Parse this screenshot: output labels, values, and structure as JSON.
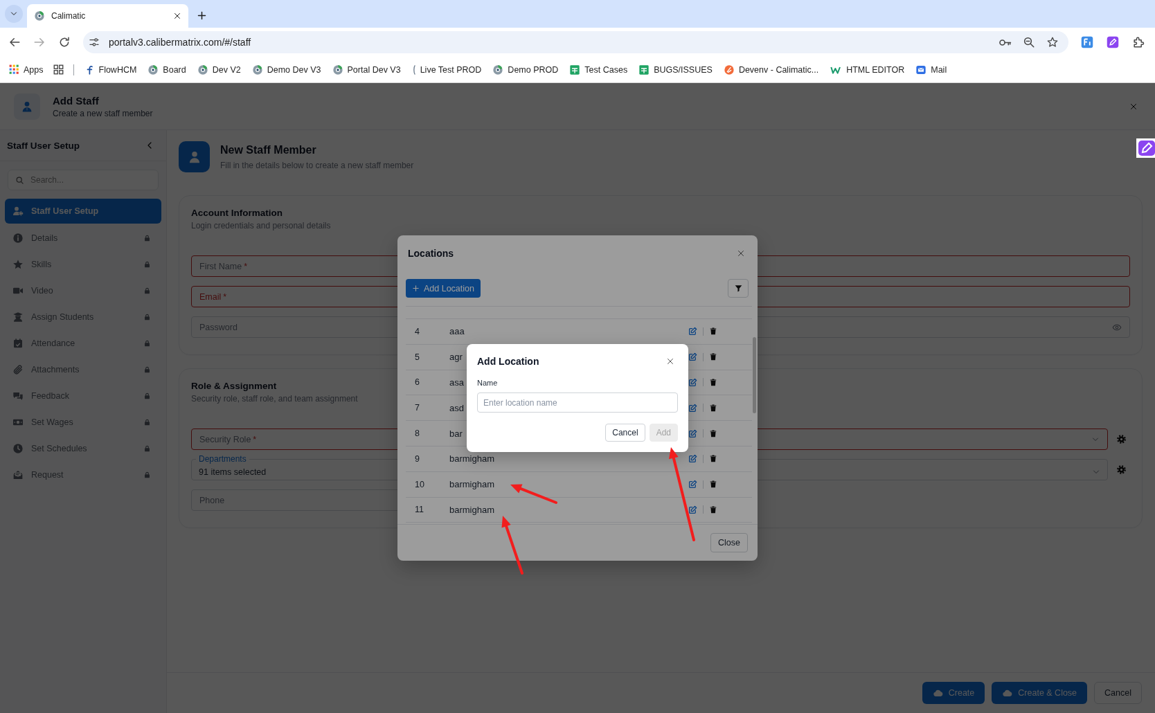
{
  "browser": {
    "tab_title": "Calimatic",
    "url": "portalv3.calibermatrix.com/#/staff",
    "bookmarks": [
      {
        "label": "Apps"
      },
      {
        "label": "FlowHCM"
      },
      {
        "label": "Board"
      },
      {
        "label": "Dev V2"
      },
      {
        "label": "Demo Dev V3"
      },
      {
        "label": "Portal Dev V3"
      },
      {
        "label": "Live Test PROD"
      },
      {
        "label": "Demo PROD"
      },
      {
        "label": "Test Cases"
      },
      {
        "label": "BUGS/ISSUES"
      },
      {
        "label": "Devenv - Calimatic..."
      },
      {
        "label": "HTML EDITOR"
      },
      {
        "label": "Mail"
      }
    ]
  },
  "header": {
    "title": "Add Staff",
    "subtitle": "Create a new staff member"
  },
  "sidebar": {
    "title": "Staff User Setup",
    "search_placeholder": "Search...",
    "items": [
      {
        "label": "Staff User Setup",
        "selected": true,
        "locked": false
      },
      {
        "label": "Details",
        "selected": false,
        "locked": true
      },
      {
        "label": "Skills",
        "selected": false,
        "locked": true
      },
      {
        "label": "Video",
        "selected": false,
        "locked": true
      },
      {
        "label": "Assign Students",
        "selected": false,
        "locked": true
      },
      {
        "label": "Attendance",
        "selected": false,
        "locked": true
      },
      {
        "label": "Attachments",
        "selected": false,
        "locked": true
      },
      {
        "label": "Feedback",
        "selected": false,
        "locked": true
      },
      {
        "label": "Set Wages",
        "selected": false,
        "locked": true
      },
      {
        "label": "Set Schedules",
        "selected": false,
        "locked": true
      },
      {
        "label": "Request",
        "selected": false,
        "locked": true
      }
    ]
  },
  "form": {
    "heading": "New Staff Member",
    "subheading": "Fill in the details below to create a new staff member",
    "sections": [
      {
        "title": "Account Information",
        "subtitle": "Login credentials and personal details",
        "fields": [
          {
            "kind": "text",
            "label": "First Name",
            "required_mark": "*",
            "error": true,
            "active": false
          },
          {
            "kind": "text",
            "label": "Email",
            "required_mark": "*",
            "error": true,
            "active": true
          },
          {
            "kind": "password",
            "label": "Password",
            "error": false,
            "active": false
          }
        ]
      },
      {
        "title": "Role & Assignment",
        "subtitle": "Security role, staff role, and team assignment",
        "fields": [
          {
            "kind": "select",
            "label": "Security Role",
            "required_mark": "*",
            "error": true,
            "active": false
          },
          {
            "kind": "multiselect",
            "label": "Departments",
            "value": "91 items selected",
            "error": false,
            "active": true
          },
          {
            "kind": "phone",
            "label": "Phone",
            "error": false,
            "active": false
          }
        ]
      }
    ]
  },
  "footer": {
    "buttons": [
      {
        "label": "Create",
        "kind": "primary"
      },
      {
        "label": "Create & Close",
        "kind": "primary"
      },
      {
        "label": "Cancel",
        "kind": "secondary"
      }
    ]
  },
  "locations_dialog": {
    "title": "Locations",
    "add_button": "Add Location",
    "close_button": "Close",
    "rows": [
      {
        "number": "4",
        "name": "aaa"
      },
      {
        "number": "5",
        "name": "agr"
      },
      {
        "number": "6",
        "name": "asa"
      },
      {
        "number": "7",
        "name": "asd"
      },
      {
        "number": "8",
        "name": "bar"
      },
      {
        "number": "9",
        "name": "barmigham"
      },
      {
        "number": "10",
        "name": "barmigham"
      },
      {
        "number": "11",
        "name": "barmigham"
      }
    ]
  },
  "add_location_dialog": {
    "title": "Add Location",
    "field_label": "Name",
    "placeholder": "Enter location name",
    "cancel_button": "Cancel",
    "add_button": {
      "label": "Add",
      "disabled": true
    }
  }
}
